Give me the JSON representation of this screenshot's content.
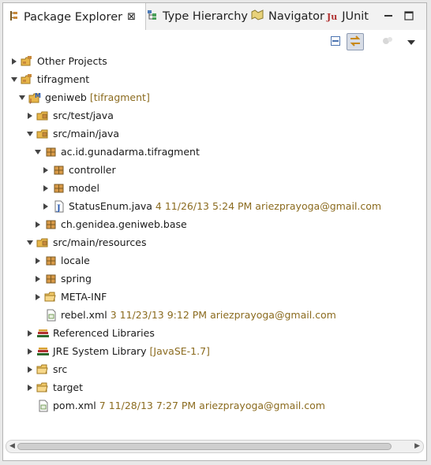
{
  "tabs": [
    {
      "label": "Package Explorer",
      "close": "⊠",
      "icon": "package-explorer-icon"
    },
    {
      "label": "Type Hierarchy",
      "icon": "type-hierarchy-icon"
    },
    {
      "label": "Navigator",
      "icon": "navigator-icon"
    },
    {
      "label": "JUnit",
      "icon_text": "Ju",
      "icon": "junit-icon"
    }
  ],
  "window_controls": {
    "minimize": "minimize-icon",
    "maximize": "maximize-icon"
  },
  "toolbar": {
    "collapse_all": "collapse-all-icon",
    "link_with_editor": "link-with-editor-icon",
    "focus": "focus-icon",
    "view_menu": "view-menu-icon"
  },
  "tree": [
    {
      "label": "Other Projects",
      "expanded": false,
      "icon": "working-set-icon"
    },
    {
      "label": "tifragment",
      "expanded": true,
      "icon": "working-set-icon"
    },
    {
      "label": "geniweb",
      "decoration": "[tifragment]",
      "expanded": true,
      "icon": "maven-project-icon"
    },
    {
      "label": "src/test/java",
      "expanded": false,
      "icon": "source-folder-icon"
    },
    {
      "label": "src/main/java",
      "expanded": true,
      "icon": "source-folder-icon"
    },
    {
      "label": "ac.id.gunadarma.tifragment",
      "expanded": true,
      "icon": "package-icon"
    },
    {
      "label": "controller",
      "expanded": false,
      "icon": "package-icon"
    },
    {
      "label": "model",
      "expanded": false,
      "icon": "package-icon"
    },
    {
      "label": "StatusEnum.java",
      "decoration": "4  11/26/13 5:24 PM  ariezprayoga@gmail.com",
      "expanded": false,
      "icon": "java-file-icon"
    },
    {
      "label": "ch.genidea.geniweb.base",
      "expanded": false,
      "icon": "package-icon"
    },
    {
      "label": "src/main/resources",
      "expanded": true,
      "icon": "source-folder-icon"
    },
    {
      "label": "locale",
      "expanded": false,
      "icon": "package-icon"
    },
    {
      "label": "spring",
      "expanded": false,
      "icon": "package-icon"
    },
    {
      "label": "META-INF",
      "expanded": false,
      "icon": "folder-icon"
    },
    {
      "label": "rebel.xml",
      "decoration": "3  11/23/13 9:12 PM  ariezprayoga@gmail.com",
      "icon": "xml-file-icon"
    },
    {
      "label": "Referenced Libraries",
      "expanded": false,
      "icon": "library-icon"
    },
    {
      "label": "JRE System Library",
      "decoration": "[JavaSE-1.7]",
      "expanded": false,
      "icon": "library-icon"
    },
    {
      "label": "src",
      "expanded": false,
      "icon": "folder-icon"
    },
    {
      "label": "target",
      "expanded": false,
      "icon": "folder-icon"
    },
    {
      "label": "pom.xml",
      "decoration": "7  11/28/13 7:27 PM  ariezprayoga@gmail.com",
      "icon": "xml-file-icon"
    }
  ],
  "colors": {
    "decoration": "#8b6b1f",
    "folder": "#e8b64a",
    "package": "#c8893a",
    "selection_bg": "#d8dde6"
  }
}
